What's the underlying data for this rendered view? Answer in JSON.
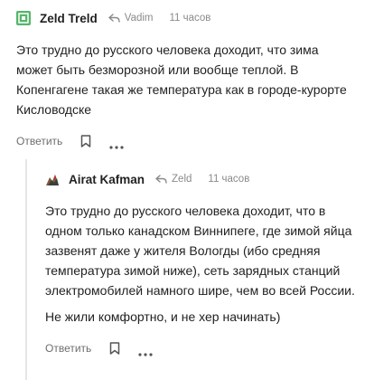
{
  "comments": [
    {
      "author": "Zeld Treld",
      "reply_to": "Vadim",
      "time": "11 часов",
      "avatar_color": "#56b56c",
      "paragraphs": [
        "Это трудно до русского человека доходит, что зима может быть безморозной или вообще теплой. В Копенгагене такая же температура как в городе-курорте Кисловодске"
      ],
      "reply_label": "Ответить"
    },
    {
      "author": "Airat Kafman",
      "reply_to": "Zeld",
      "time": "11 часов",
      "paragraphs": [
        "Это трудно до русского человека доходит, что в одном только канадском Виннипеге, где зимой яйца зазвенят даже у жителя Вологды (ибо средняя температура зимой ниже), сеть зарядных станций электромобилей намного шире, чем во всей России.",
        "Не жили комфортно, и не хер начинать)"
      ],
      "reply_label": "Ответить"
    }
  ],
  "icons": {
    "reply": "reply-arrow-icon",
    "bookmark": "bookmark-icon",
    "more": "more-options-icon"
  }
}
